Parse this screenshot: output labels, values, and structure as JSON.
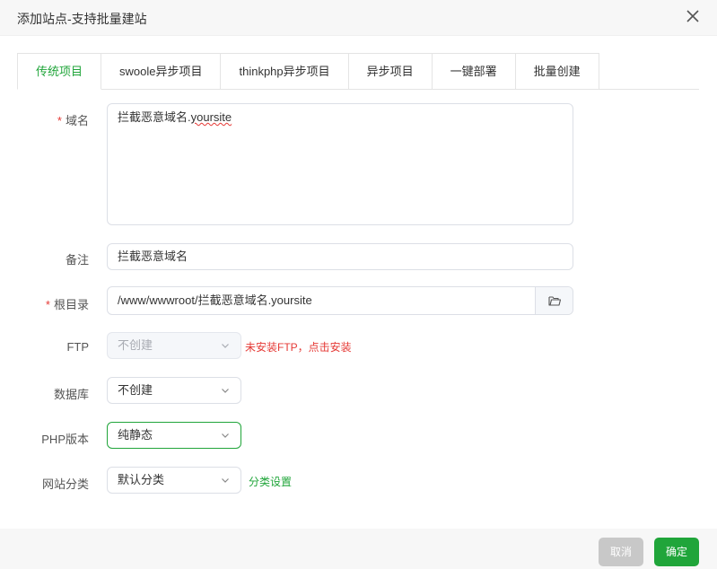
{
  "dialog": {
    "title": "添加站点-支持批量建站"
  },
  "tabs": [
    {
      "label": "传统项目",
      "active": true
    },
    {
      "label": "swoole异步项目",
      "active": false
    },
    {
      "label": "thinkphp异步项目",
      "active": false
    },
    {
      "label": "异步项目",
      "active": false
    },
    {
      "label": "一键部署",
      "active": false
    },
    {
      "label": "批量创建",
      "active": false
    }
  ],
  "form": {
    "domain": {
      "label": "域名",
      "required": true,
      "value_prefix": "拦截恶意域名.",
      "value_suffix": "yoursite"
    },
    "remark": {
      "label": "备注",
      "value": "拦截恶意域名"
    },
    "root_dir": {
      "label": "根目录",
      "required": true,
      "value": "/www/wwwroot/拦截恶意域名.yoursite"
    },
    "ftp": {
      "label": "FTP",
      "value": "不创建",
      "hint": "未安装FTP，点击安装"
    },
    "database": {
      "label": "数据库",
      "value": "不创建"
    },
    "php_version": {
      "label": "PHP版本",
      "value": "纯静态"
    },
    "site_category": {
      "label": "网站分类",
      "value": "默认分类",
      "link": "分类设置"
    }
  },
  "footer": {
    "cancel_label": "取消",
    "ok_label": "确定"
  },
  "colors": {
    "accent": "#20a53a",
    "danger": "#e53935",
    "cancel_bg": "#c8c8c8"
  },
  "icons": {
    "close": "close-icon",
    "folder": "folder-icon",
    "chevron": "chevron-down-icon"
  }
}
